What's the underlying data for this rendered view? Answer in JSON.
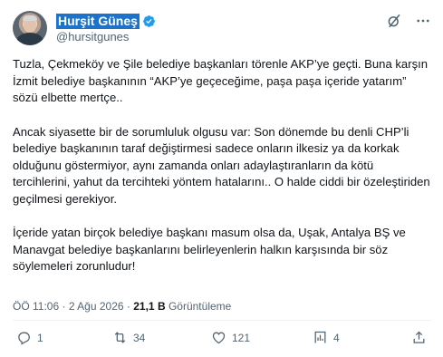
{
  "author": {
    "display_name": "Hurşit Güneş",
    "handle": "@hursitgunes"
  },
  "tweet": {
    "paragraphs": [
      "Tuzla, Çekmeköy ve Şile belediye başkanları törenle AKP’ye geçti. Buna karşın İzmit belediye başkanının “AKP’ye geçeceğime, paşa paşa içeride yatarım” sözü elbette mertçe..",
      "Ancak siyasette bir de sorumluluk olgusu var: Son dönemde bu denli CHP’li belediye başkanının taraf değiştirmesi sadece onların ilkesiz ya da korkak olduğunu göstermiyor, aynı zamanda onları adaylaştıranların da kötü tercihlerini, yahut da tercihteki yöntem hatalarını.. O halde ciddi bir özeleştiriden geçilmesi gerekiyor.",
      "İçeride yatan birçok belediye başkanı masum olsa da, Uşak, Antalya BŞ ve Manavgat belediye başkanlarını belirleyenlerin halkın karşısında bir söz söylemeleri zorunludur!"
    ]
  },
  "meta": {
    "time": "ÖÖ 11:06",
    "separator": "·",
    "date": "2 Ağu 2026",
    "views_count": "21,1 B",
    "views_label": "Görüntüleme"
  },
  "actions": {
    "replies": "1",
    "reposts": "34",
    "likes": "121",
    "bookmarks": "4"
  },
  "colors": {
    "text": "#0f1419",
    "secondary": "#536471",
    "verified": "#1d9bf0",
    "name_highlight": "#1d73c9"
  },
  "icons": [
    "verified-badge-icon",
    "grok-icon",
    "more-icon",
    "reply-icon",
    "repost-icon",
    "like-icon",
    "bookmark-icon",
    "share-icon"
  ]
}
